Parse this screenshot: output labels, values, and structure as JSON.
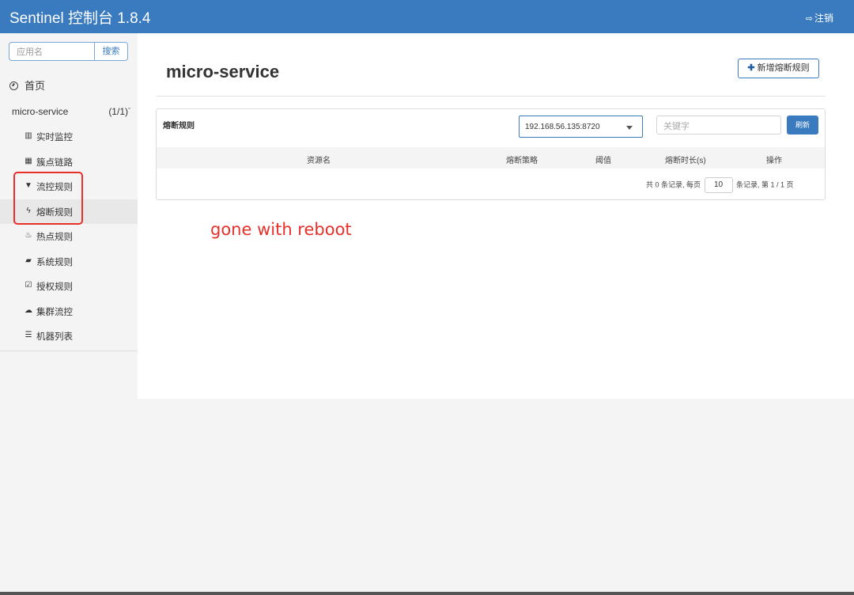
{
  "header": {
    "brand": "Sentinel 控制台 1.8.4",
    "logout_icon": "sign-out-icon",
    "logout_label": "注销"
  },
  "sidebar": {
    "search_placeholder": "应用名",
    "search_button": "搜索",
    "home_label": "首页",
    "app_name": "micro-service",
    "app_count": "(1/1)",
    "items": [
      {
        "label": "实时监控",
        "icon": "bar-chart-icon",
        "glyph": "▥"
      },
      {
        "label": "簇点链路",
        "icon": "list-table-icon",
        "glyph": "▦"
      },
      {
        "label": "流控规则",
        "icon": "filter-icon",
        "glyph": "▼"
      },
      {
        "label": "熔断规则",
        "icon": "flash-icon",
        "glyph": "ϟ"
      },
      {
        "label": "热点规则",
        "icon": "fire-icon",
        "glyph": "♨"
      },
      {
        "label": "系统规则",
        "icon": "lock-icon",
        "glyph": "▰"
      },
      {
        "label": "授权规则",
        "icon": "check-square-icon",
        "glyph": "☑"
      },
      {
        "label": "集群流控",
        "icon": "cloud-icon",
        "glyph": "☁"
      },
      {
        "label": "机器列表",
        "icon": "th-list-icon",
        "glyph": "☰"
      }
    ],
    "active_item": "熔断规则"
  },
  "main": {
    "title": "micro-service",
    "add_button": "新增熔断规则",
    "card_title": "熔断规则",
    "machine_selected": "192.168.56.135:8720",
    "keyword_placeholder": "关键字",
    "refresh_button": "刷新",
    "columns": [
      "资源名",
      "熔断策略",
      "阈值",
      "熔断时长(s)",
      "操作"
    ],
    "pager_prefix": "共 0 条记录, 每页",
    "page_size": "10",
    "pager_suffix": "条记录, 第 1 / 1 页"
  },
  "annotation": "gone with reboot",
  "colors": {
    "header": "#3a7bc0",
    "annotation": "#e8302a"
  }
}
